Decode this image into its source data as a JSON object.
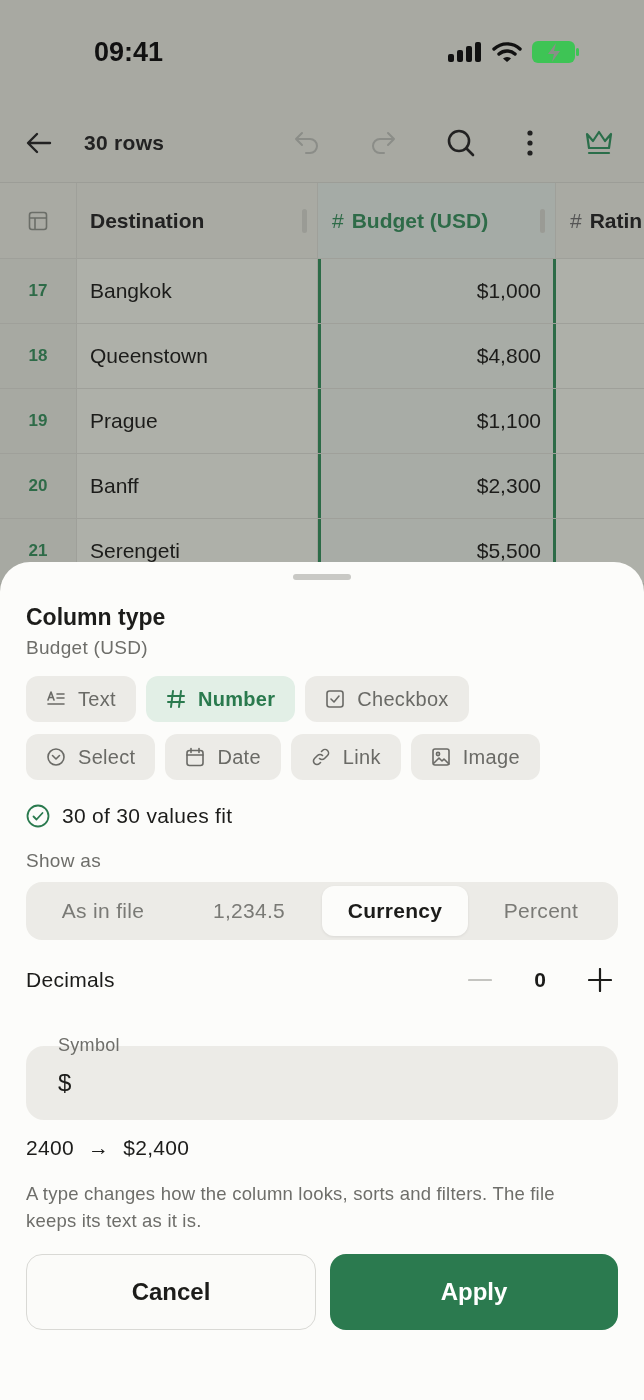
{
  "status_bar": {
    "time": "09:41"
  },
  "toolbar": {
    "title": "30 rows",
    "undo": {
      "disabled": true
    },
    "redo": {
      "disabled": true
    }
  },
  "table": {
    "columns": [
      {
        "label": "Destination",
        "selected": false
      },
      {
        "symbol": "#",
        "label": "Budget (USD)",
        "selected": true
      },
      {
        "symbol": "#",
        "label": "Ratin",
        "selected": false
      }
    ],
    "rows": [
      {
        "number": "17",
        "cells": [
          "Bangkok",
          "$1,000"
        ]
      },
      {
        "number": "18",
        "cells": [
          "Queenstown",
          "$4,800"
        ]
      },
      {
        "number": "19",
        "cells": [
          "Prague",
          "$1,100"
        ]
      },
      {
        "number": "20",
        "cells": [
          "Banff",
          "$2,300"
        ]
      },
      {
        "number": "21",
        "cells": [
          "Serengeti",
          "$5,500"
        ]
      }
    ]
  },
  "sheet": {
    "title": "Column type",
    "subtitle": "Budget (USD)",
    "types": [
      {
        "kind": "text",
        "label": "Text",
        "selected": false
      },
      {
        "kind": "number",
        "label": "Number",
        "selected": true
      },
      {
        "kind": "checkbox",
        "label": "Checkbox",
        "selected": false
      },
      {
        "kind": "select",
        "label": "Select",
        "selected": false
      },
      {
        "kind": "date",
        "label": "Date",
        "selected": false
      },
      {
        "kind": "link",
        "label": "Link",
        "selected": false
      },
      {
        "kind": "image",
        "label": "Image",
        "selected": false
      }
    ],
    "fit_status": "30 of 30 values fit",
    "show_as": {
      "label": "Show as",
      "options": [
        {
          "label": "As in file",
          "selected": false
        },
        {
          "label": "1,234.5",
          "selected": false
        },
        {
          "label": "Currency",
          "selected": true
        },
        {
          "label": "Percent",
          "selected": false
        }
      ]
    },
    "decimals": {
      "label": "Decimals",
      "value": "0",
      "minus_disabled": true,
      "plus_disabled": false
    },
    "symbol": {
      "label": "Symbol",
      "value": "$"
    },
    "preview": {
      "from": "2400",
      "arrow": "→",
      "to": "$2,400"
    },
    "note": "A type changes how the column looks, sorts and filters. The file keeps its text as it is.",
    "buttons": [
      {
        "kind": "secondary",
        "label": "Cancel"
      },
      {
        "kind": "primary",
        "label": "Apply"
      }
    ]
  }
}
